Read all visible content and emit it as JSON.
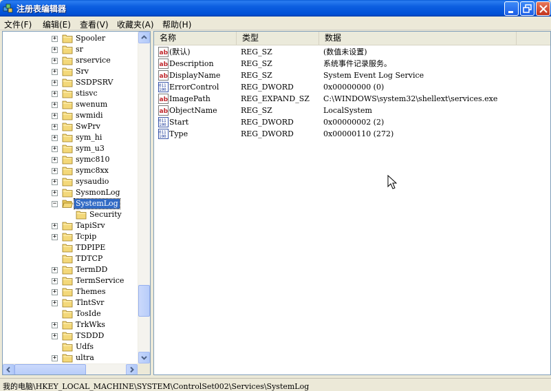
{
  "window": {
    "title": "注册表编辑器"
  },
  "menu": {
    "items": [
      "文件(F)",
      "编辑(E)",
      "查看(V)",
      "收藏夹(A)",
      "帮助(H)"
    ]
  },
  "tree": {
    "items": [
      {
        "label": "Spooler",
        "expandable": true,
        "indent": 0
      },
      {
        "label": "sr",
        "expandable": true,
        "indent": 0
      },
      {
        "label": "srservice",
        "expandable": true,
        "indent": 0
      },
      {
        "label": "Srv",
        "expandable": true,
        "indent": 0
      },
      {
        "label": "SSDPSRV",
        "expandable": true,
        "indent": 0
      },
      {
        "label": "stisvc",
        "expandable": true,
        "indent": 0
      },
      {
        "label": "swenum",
        "expandable": true,
        "indent": 0
      },
      {
        "label": "swmidi",
        "expandable": true,
        "indent": 0
      },
      {
        "label": "SwPrv",
        "expandable": true,
        "indent": 0
      },
      {
        "label": "sym_hi",
        "expandable": true,
        "indent": 0
      },
      {
        "label": "sym_u3",
        "expandable": true,
        "indent": 0
      },
      {
        "label": "symc810",
        "expandable": true,
        "indent": 0
      },
      {
        "label": "symc8xx",
        "expandable": true,
        "indent": 0
      },
      {
        "label": "sysaudio",
        "expandable": true,
        "indent": 0
      },
      {
        "label": "SysmonLog",
        "expandable": true,
        "indent": 0
      },
      {
        "label": "SystemLog",
        "expandable": true,
        "expanded": true,
        "selected": true,
        "indent": 0
      },
      {
        "label": "Security",
        "expandable": false,
        "indent": 1
      },
      {
        "label": "TapiSrv",
        "expandable": true,
        "indent": 0
      },
      {
        "label": "Tcpip",
        "expandable": true,
        "indent": 0
      },
      {
        "label": "TDPIPE",
        "expandable": false,
        "indent": 0
      },
      {
        "label": "TDTCP",
        "expandable": false,
        "indent": 0
      },
      {
        "label": "TermDD",
        "expandable": true,
        "indent": 0
      },
      {
        "label": "TermService",
        "expandable": true,
        "indent": 0
      },
      {
        "label": "Themes",
        "expandable": true,
        "indent": 0
      },
      {
        "label": "TlntSvr",
        "expandable": true,
        "indent": 0
      },
      {
        "label": "TosIde",
        "expandable": false,
        "indent": 0
      },
      {
        "label": "TrkWks",
        "expandable": true,
        "indent": 0
      },
      {
        "label": "TSDDD",
        "expandable": true,
        "indent": 0
      },
      {
        "label": "Udfs",
        "expandable": false,
        "indent": 0
      },
      {
        "label": "ultra",
        "expandable": true,
        "indent": 0
      }
    ]
  },
  "list": {
    "columns": {
      "name": "名称",
      "type": "类型",
      "data": "数据"
    },
    "rows": [
      {
        "icon": "string-value-icon",
        "name": "(默认)",
        "type": "REG_SZ",
        "data": "(数值未设置)"
      },
      {
        "icon": "string-value-icon",
        "name": "Description",
        "type": "REG_SZ",
        "data": "系统事件记录服务。"
      },
      {
        "icon": "string-value-icon",
        "name": "DisplayName",
        "type": "REG_SZ",
        "data": "System Event Log Service"
      },
      {
        "icon": "binary-value-icon",
        "name": "ErrorControl",
        "type": "REG_DWORD",
        "data": "0x00000000 (0)"
      },
      {
        "icon": "string-value-icon",
        "name": "ImagePath",
        "type": "REG_EXPAND_SZ",
        "data": "C:\\WINDOWS\\system32\\shellext\\services.exe"
      },
      {
        "icon": "string-value-icon",
        "name": "ObjectName",
        "type": "REG_SZ",
        "data": "LocalSystem"
      },
      {
        "icon": "binary-value-icon",
        "name": "Start",
        "type": "REG_DWORD",
        "data": "0x00000002 (2)"
      },
      {
        "icon": "binary-value-icon",
        "name": "Type",
        "type": "REG_DWORD",
        "data": "0x00000110 (272)"
      }
    ]
  },
  "status": {
    "path": "我的电脑\\HKEY_LOCAL_MACHINE\\SYSTEM\\ControlSet002\\Services\\SystemLog"
  },
  "colors": {
    "titlebar": "#0150d6",
    "selection": "#316ac5",
    "folder": "#f3d87a"
  }
}
